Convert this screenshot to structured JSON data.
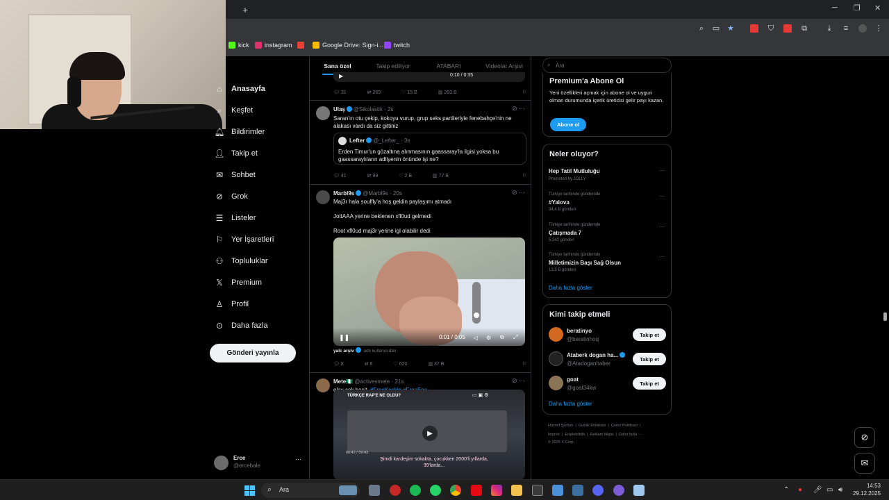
{
  "browser": {
    "new_tab": "+",
    "bookmarks": [
      {
        "label": "kick",
        "color": "#53fc18"
      },
      {
        "label": "instagram",
        "color": "#e1306c"
      },
      {
        "label": "",
        "color": "#ea4335"
      },
      {
        "label": "Google Drive: Sign-i...",
        "color": "#fbbc04"
      },
      {
        "label": "twitch",
        "color": "#9146ff"
      }
    ],
    "window": {
      "minimize": "─",
      "restore": "❐",
      "close": "✕"
    }
  },
  "nav": {
    "items": [
      {
        "label": "Anasayfa",
        "icon": "home-icon"
      },
      {
        "label": "Keşfet",
        "icon": "search-icon"
      },
      {
        "label": "Bildirimler",
        "icon": "bell-icon"
      },
      {
        "label": "Takip et",
        "icon": "add-user-icon"
      },
      {
        "label": "Sohbet",
        "icon": "mail-icon"
      },
      {
        "label": "Grok",
        "icon": "grok-icon"
      },
      {
        "label": "Listeler",
        "icon": "list-icon"
      },
      {
        "label": "Yer İşaretleri",
        "icon": "bookmark-icon"
      },
      {
        "label": "Topluluklar",
        "icon": "communities-icon"
      },
      {
        "label": "Premium",
        "icon": "x-icon"
      },
      {
        "label": "Profil",
        "icon": "person-icon"
      },
      {
        "label": "Daha fazla",
        "icon": "more-icon"
      }
    ],
    "post_button": "Gönderi yayınla",
    "account": {
      "name": "Erce",
      "handle": "@ercebale"
    }
  },
  "timeline": {
    "tabs": [
      "Sana özel",
      "Takip ediliyor",
      "ATABARI",
      "Videolar Arşivi"
    ],
    "top_stats": {
      "replies": "31",
      "reposts": "269",
      "likes": "15 B",
      "views": "293 B",
      "time": "0:10 / 0:35"
    },
    "tweets": [
      {
        "name": "Ulaş",
        "handle": "@Sikolastik",
        "time": "· 2s",
        "text": "Saran'ın otu çekip, kokoyu vurup, grup seks partileriyle fenebahçe'nin ne alakası vardı da siz gittiniz",
        "quote": {
          "name": "Lefter",
          "handle": "@_Lefter_",
          "time": "· 3s",
          "text": "Erden Timur'un gözaltına alınmasının gaassaray'la ilgisi yoksa bu gaassaraylıların adliyenin önünde işi ne?"
        },
        "stats": {
          "replies": "41",
          "reposts": "99",
          "likes": "2 B",
          "views": "77 B"
        }
      },
      {
        "name": "Marbl9s",
        "handle": "@Marbl9s",
        "time": "· 20s",
        "lines": [
          "Maj3r hala soulfly'a hoş geldin paylaşımı atmadı",
          "JottAAA yerine beklenen xfl0ud gelmedi",
          "Root xfl0ud maj3r yerine igl olabilir dedi"
        ],
        "video_time": "0:01 / 0:05",
        "video_source_name": "yalc arşiv",
        "video_source_note": "adlı kullanıcıdan",
        "stats": {
          "replies": "8",
          "reposts": "6",
          "likes": "620",
          "views": "37 B"
        }
      },
      {
        "name": "Mete🇳🇬",
        "handle": "@activesmete",
        "time": "· 21s",
        "text": "olay çok basit.",
        "hashtags": "#FreeKeskin #FreeEge",
        "video_title": "TÜRKÇE RAP'E NE OLDU?",
        "video_caption": "Şimdi kardeşim sokakta, çocukken 2000'li yıllarda, 99'larda...",
        "video_time": "06:42 / 09:43"
      }
    ]
  },
  "right": {
    "search_placeholder": "Ara",
    "premium": {
      "title": "Premium'a Abone Ol",
      "text": "Yeni özellikleri açmak için abone ol ve uygun olman durumunda içerik üreticisi gelir payı kazan.",
      "button": "Abone ol"
    },
    "trends": {
      "title": "Neler oluyor?",
      "items": [
        {
          "sub": "",
          "name": "Hep Tatil Mutluluğu",
          "count": "Promoted by JOLLY"
        },
        {
          "sub": "Türkiye tarihinde gündemde",
          "name": "#Yalova",
          "count": "34,4 B gönderi"
        },
        {
          "sub": "Türkiye tarihinde gündemde",
          "name": "Çatışmada 7",
          "count": "5.242 gönderi"
        },
        {
          "sub": "Türkiye tarihinde gündemde",
          "name": "Milletimizin Başı Sağ Olsun",
          "count": "13,5 B gönderi"
        }
      ],
      "more": "Daha fazla göster"
    },
    "who_to_follow": {
      "title": "Kimi takip etmeli",
      "items": [
        {
          "name": "beratinyo",
          "handle": "@beratinhoq",
          "button": "Takip et"
        },
        {
          "name": "Ataberk dogan ha...",
          "handle": "@Atadoganhaber",
          "button": "Takip et"
        },
        {
          "name": "goat",
          "handle": "@goat34kw",
          "button": "Takip et"
        }
      ],
      "more": "Daha fazla göster"
    },
    "footer": {
      "line1": [
        "Hizmet Şartları",
        "Gizlilik Politikası",
        "Çerez Politikası"
      ],
      "line2": [
        "Imprint",
        "Erişilebilirlik",
        "Reklam bilgisi",
        "Daha fazla ···"
      ],
      "copyright": "© 2025 X Corp."
    }
  },
  "taskbar": {
    "search_label": "Ara",
    "time": "14:53",
    "date": "29.12.2025"
  },
  "colors": {
    "accent": "#1d9bf0",
    "background": "#000000",
    "border": "#2f3336"
  }
}
